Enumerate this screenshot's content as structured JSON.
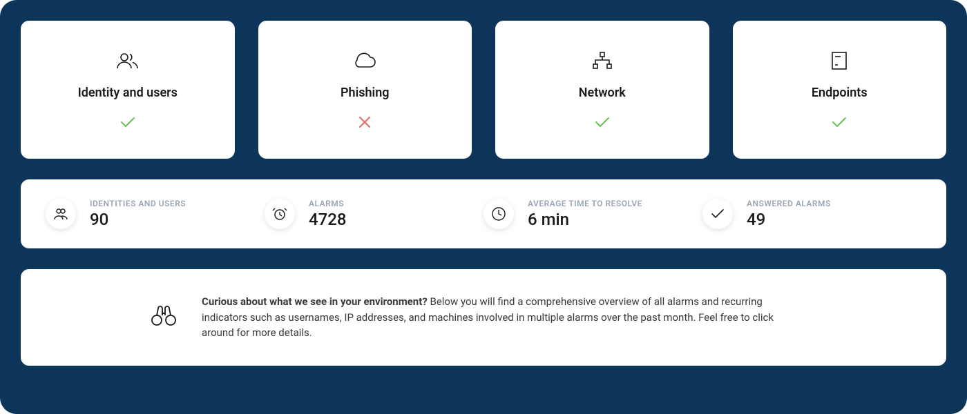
{
  "cards": [
    {
      "title": "Identity and users",
      "status": "ok"
    },
    {
      "title": "Phishing",
      "status": "fail"
    },
    {
      "title": "Network",
      "status": "ok"
    },
    {
      "title": "Endpoints",
      "status": "ok"
    }
  ],
  "stats": [
    {
      "label": "IDENTITIES AND USERS",
      "value": "90"
    },
    {
      "label": "ALARMS",
      "value": "4728"
    },
    {
      "label": "AVERAGE TIME TO RESOLVE",
      "value": "6 min"
    },
    {
      "label": "ANSWERED ALARMS",
      "value": "49"
    }
  ],
  "info": {
    "lead": "Curious about what we see in your environment?",
    "body": " Below you will find a comprehensive overview of all alarms and recurring indicators such as usernames, IP addresses, and machines involved in multiple alarms over the past month. Feel free to click around for more details."
  }
}
